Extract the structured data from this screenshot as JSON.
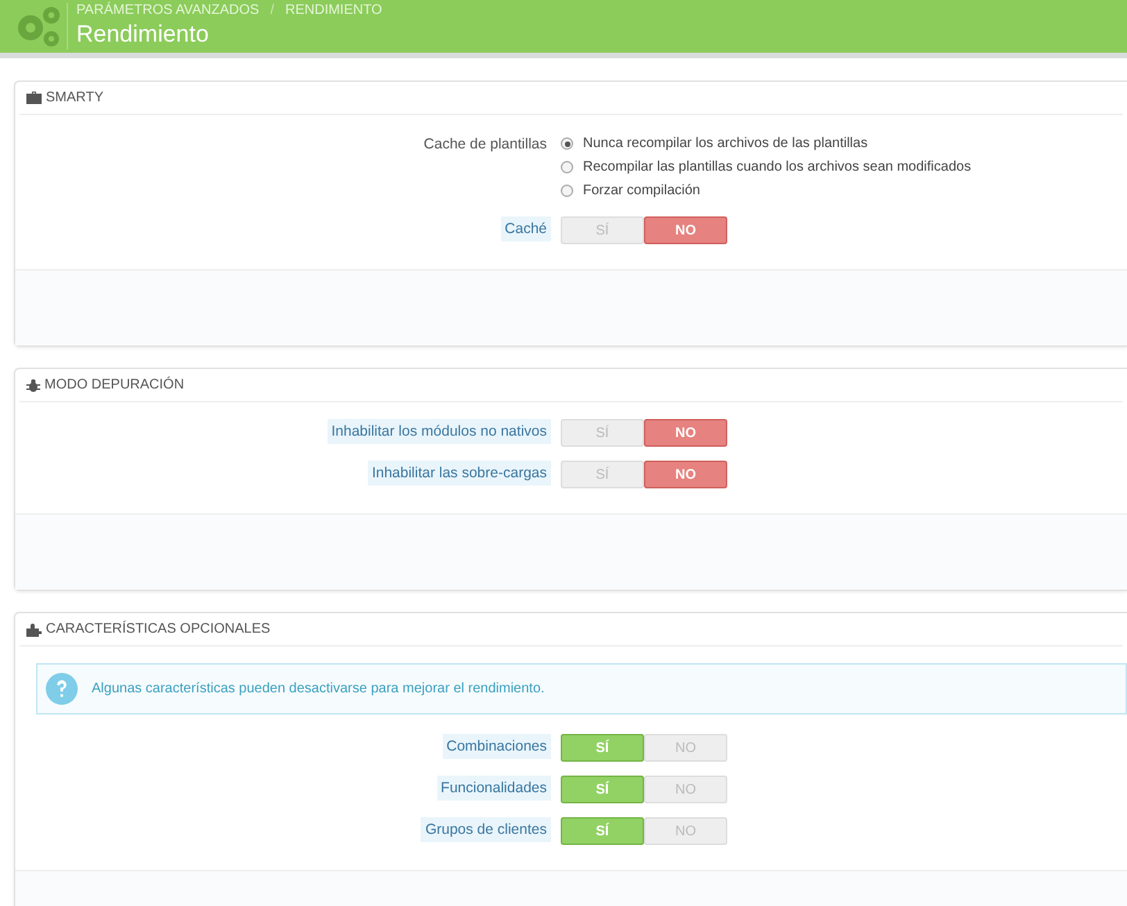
{
  "header": {
    "breadcrumb": [
      "PARÁMETROS AVANZADOS",
      "/",
      "RENDIMIENTO"
    ],
    "title": "Rendimiento"
  },
  "panels": [
    {
      "title": "SMARTY",
      "fields": [
        {
          "kind": "radio",
          "label": "Cache de plantillas",
          "help": false,
          "options": [
            {
              "label": "Nunca recompilar los archivos de las plantillas",
              "selected": true
            },
            {
              "label": "Recompilar las plantillas cuando los archivos sean modificados",
              "selected": false
            },
            {
              "label": "Forzar compilación",
              "selected": false
            }
          ]
        },
        {
          "kind": "toggle",
          "label": "Caché",
          "help": true,
          "options": [
            {
              "label": "SÍ",
              "selected": false
            },
            {
              "label": "NO",
              "selected": true
            }
          ]
        }
      ]
    },
    {
      "title": "MODO DEPURACIÓN",
      "fields": [
        {
          "kind": "toggle",
          "label": "Inhabilitar los módulos no nativos",
          "help": true,
          "options": [
            {
              "label": "SÍ",
              "selected": false
            },
            {
              "label": "NO",
              "selected": true
            }
          ]
        },
        {
          "kind": "toggle",
          "label": "Inhabilitar las sobre-cargas",
          "help": true,
          "options": [
            {
              "label": "SÍ",
              "selected": false
            },
            {
              "label": "NO",
              "selected": true
            }
          ]
        }
      ]
    },
    {
      "title": "CARACTERÍSTICAS OPCIONALES",
      "info": "Algunas características pueden desactivarse para mejorar el rendimiento.",
      "fields": [
        {
          "kind": "toggle",
          "label": "Combinaciones",
          "help": true,
          "options": [
            {
              "label": "SÍ",
              "selected": true
            },
            {
              "label": "NO",
              "selected": false
            }
          ]
        },
        {
          "kind": "toggle",
          "label": "Funcionalidades",
          "help": true,
          "options": [
            {
              "label": "SÍ",
              "selected": true
            },
            {
              "label": "NO",
              "selected": false
            }
          ]
        },
        {
          "kind": "toggle",
          "label": "Grupos de clientes",
          "help": true,
          "options": [
            {
              "label": "SÍ",
              "selected": true
            },
            {
              "label": "NO",
              "selected": false
            }
          ]
        }
      ]
    }
  ]
}
